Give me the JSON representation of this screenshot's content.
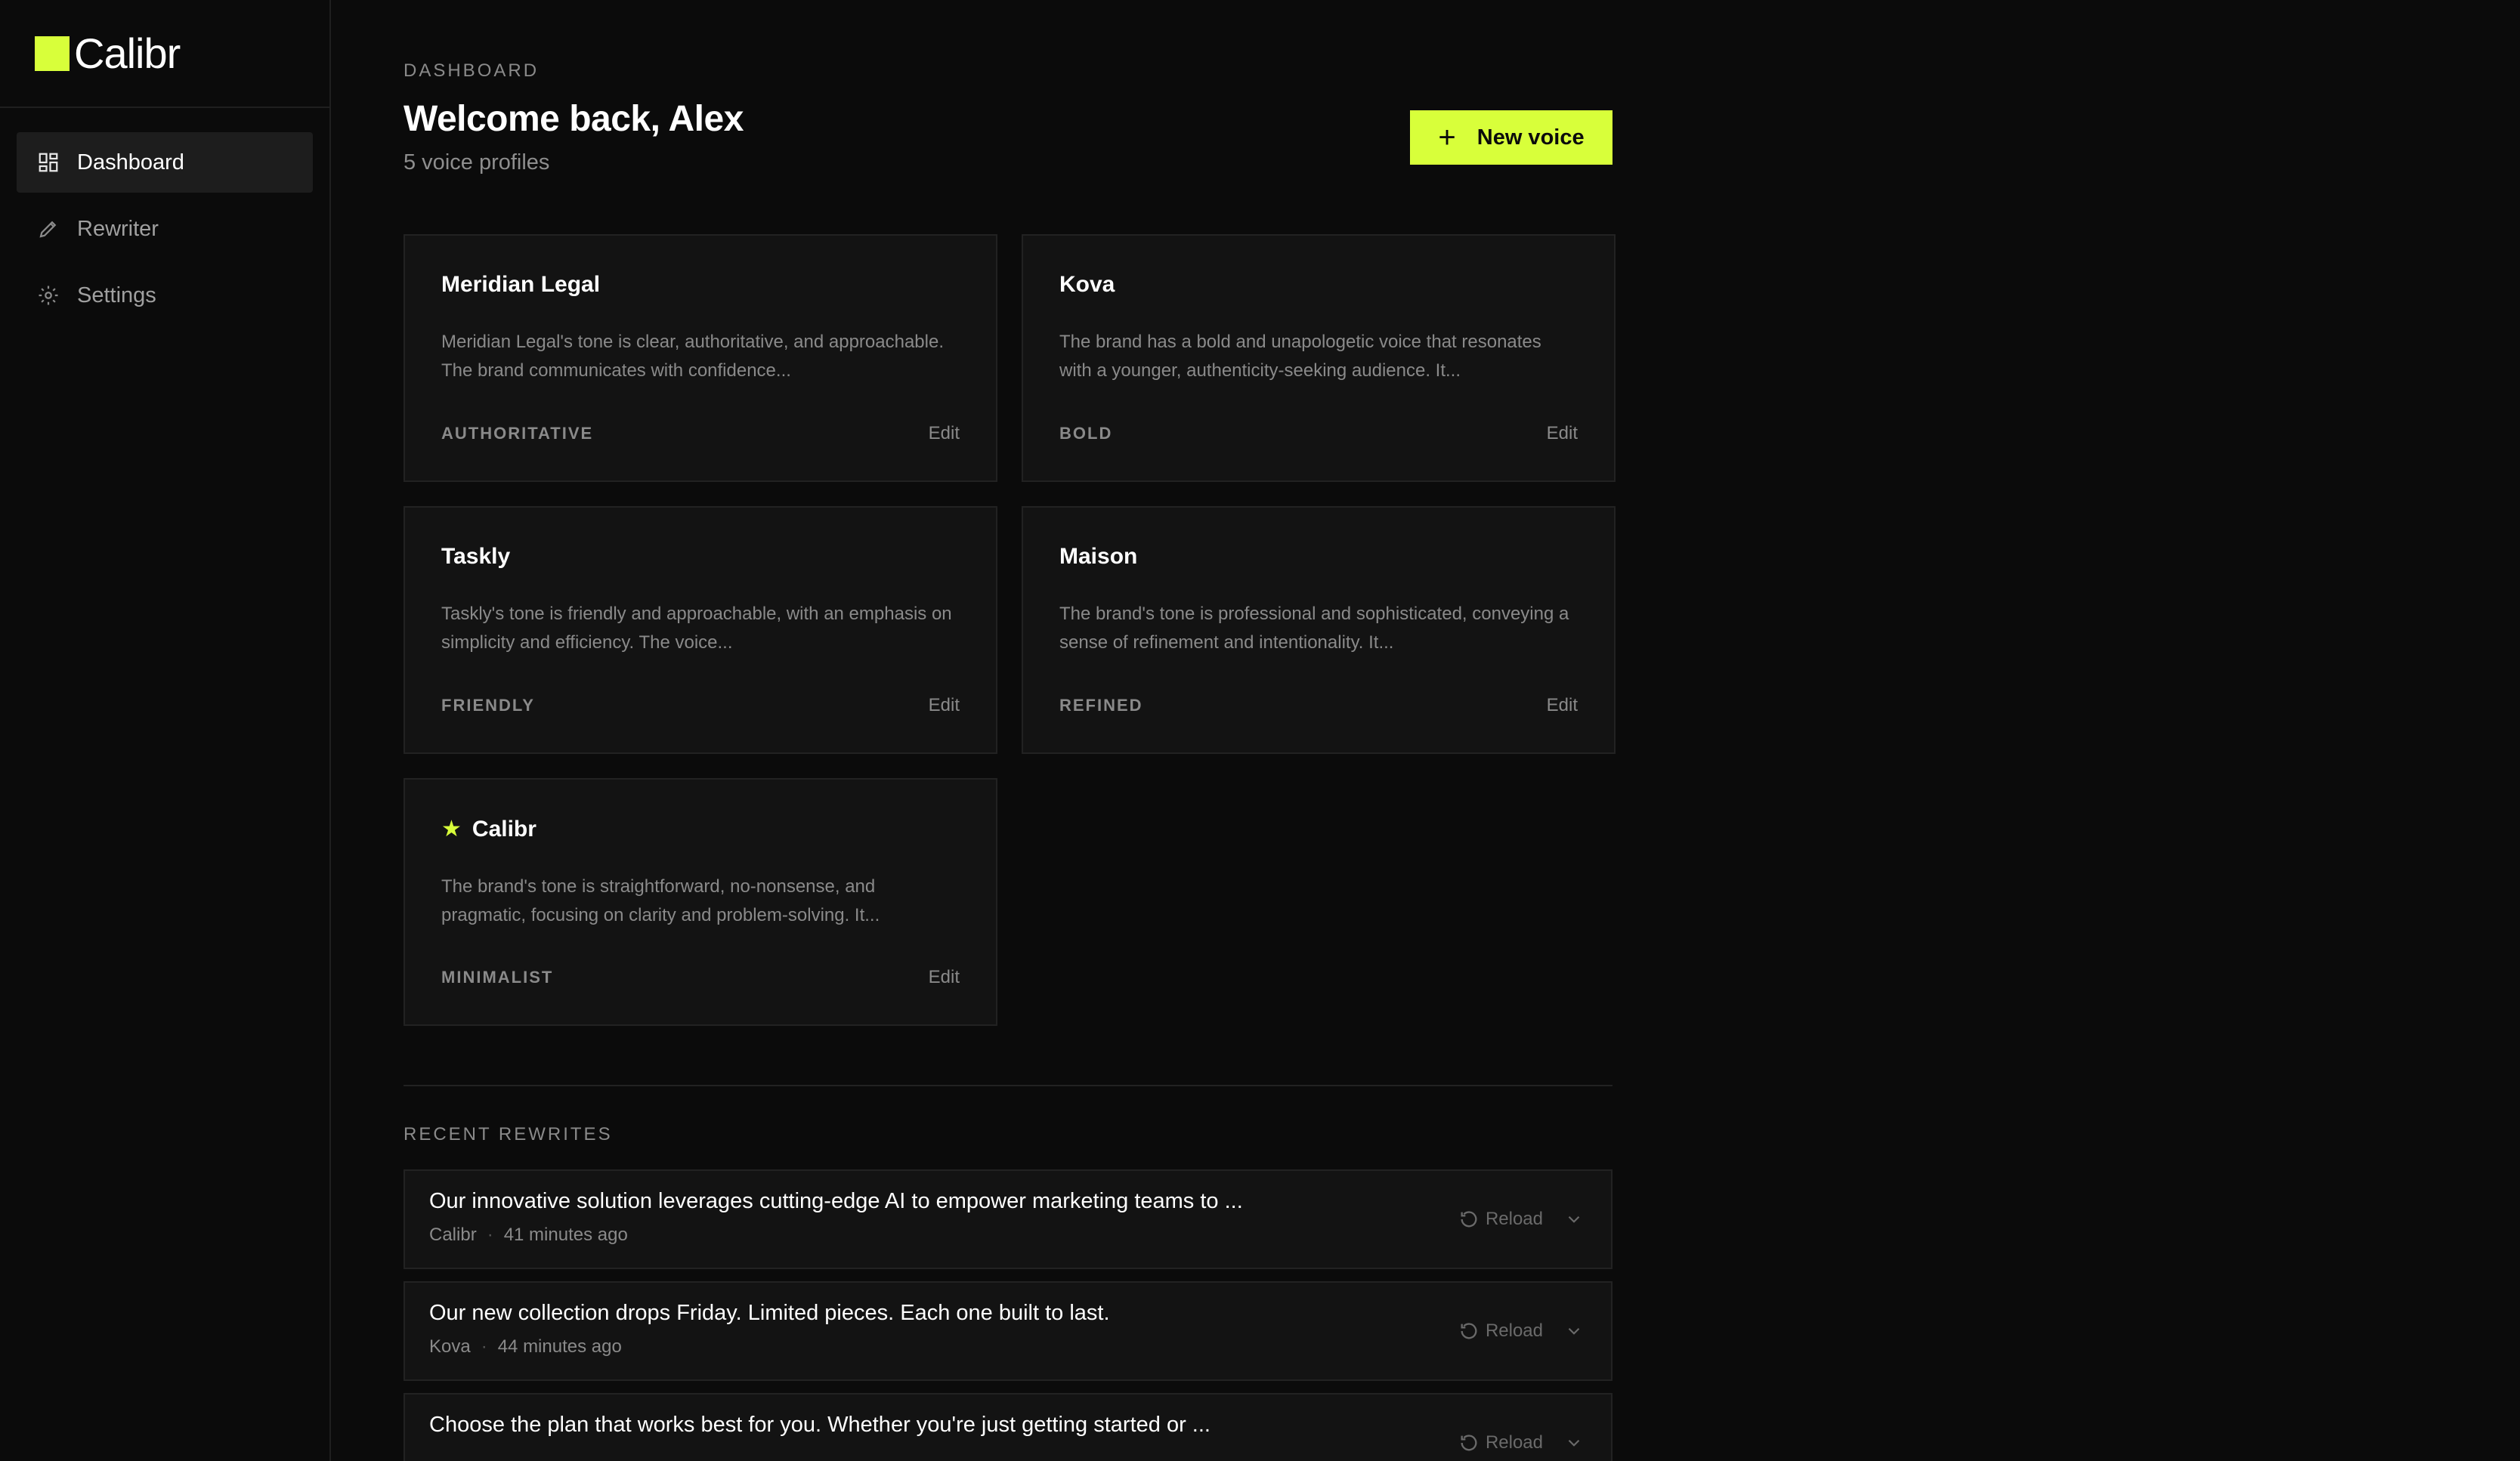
{
  "brand": {
    "name": "Calibr",
    "accent": "#d8ff3a"
  },
  "sidebar": {
    "items": [
      {
        "label": "Dashboard",
        "icon": "grid-icon",
        "active": true
      },
      {
        "label": "Rewriter",
        "icon": "pen-icon",
        "active": false
      },
      {
        "label": "Settings",
        "icon": "gear-icon",
        "active": false
      }
    ]
  },
  "header": {
    "eyebrow": "DASHBOARD",
    "title": "Welcome back, Alex",
    "subtitle": "5 voice profiles",
    "new_voice_label": "New voice"
  },
  "profiles": [
    {
      "name": "Meridian Legal",
      "desc": "Meridian Legal's tone is clear, authoritative, and approachable. The brand communicates with confidence...",
      "tag": "AUTHORITATIVE",
      "edit": "Edit",
      "starred": false
    },
    {
      "name": "Kova",
      "desc": "The brand has a bold and unapologetic voice that resonates with a younger, authenticity-seeking audience. It...",
      "tag": "BOLD",
      "edit": "Edit",
      "starred": false
    },
    {
      "name": "Taskly",
      "desc": "Taskly's tone is friendly and approachable, with an emphasis on simplicity and efficiency. The voice...",
      "tag": "FRIENDLY",
      "edit": "Edit",
      "starred": false
    },
    {
      "name": "Maison",
      "desc": "The brand's tone is professional and sophisticated, conveying a sense of refinement and intentionality. It...",
      "tag": "REFINED",
      "edit": "Edit",
      "starred": false
    },
    {
      "name": "Calibr",
      "desc": "The brand's tone is straightforward, no-nonsense, and pragmatic, focusing on clarity and problem-solving. It...",
      "tag": "MINIMALIST",
      "edit": "Edit",
      "starred": true
    }
  ],
  "recent": {
    "label": "RECENT REWRITES",
    "items": [
      {
        "text": "Our innovative solution leverages cutting-edge AI to empower marketing teams to ...",
        "profile": "Calibr",
        "time": "41 minutes ago",
        "reload": "Reload"
      },
      {
        "text": "Our new collection drops Friday. Limited pieces. Each one built to last.",
        "profile": "Kova",
        "time": "44 minutes ago",
        "reload": "Reload"
      },
      {
        "text": "Choose the plan that works best for you. Whether you're just getting started or ...",
        "profile": "",
        "time": "",
        "reload": "Reload"
      }
    ]
  }
}
